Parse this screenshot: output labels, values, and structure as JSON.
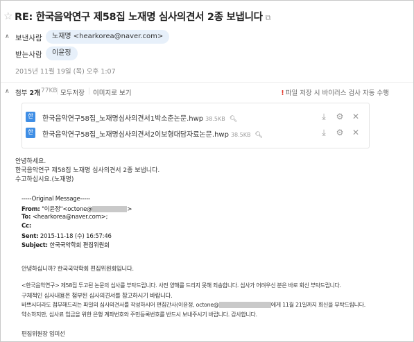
{
  "subject": "RE: 한국음악연구 제58집 노재명 심사의견서 2종 보냅니다",
  "icons": {
    "star": "star-icon",
    "external": "external-link-icon"
  },
  "sender_label": "보낸사람",
  "sender_chip": "노재명 <hearkorea@naver.com>",
  "recipient_label": "받는사람",
  "recipient_chip": "이윤정",
  "date": "2015년 11월 19일 (목) 오후 1:07",
  "attachments": {
    "title_prefix": "첨부",
    "count": "2개",
    "size": "77KB",
    "save_all": "모두저장",
    "image_view": "이미지로 보기",
    "notice_mark": "!",
    "notice": "파일 저장 시 바이러스 검사 자동 수행",
    "files": [
      {
        "icon": "한",
        "name": "한국음악연구58집_노재명심사의견서1박소춘논문.hwp",
        "size": "38.5KB"
      },
      {
        "icon": "한",
        "name": "한국음악연구58집_노재명심사의견서2이보형대담자료논문.hwp",
        "size": "38.5KB"
      }
    ]
  },
  "body_lines": [
    "안녕하세요.",
    "한국음악연구 제58집 노재명 심사의견서 2종 보냅니다.",
    "수고하십시요.(노재명)"
  ],
  "forward": {
    "header": "-----Original Message-----",
    "from_label": "From:",
    "from_value": "\"이윤정\"<octone@",
    "to_label": "To:",
    "to_value": "<hearkorea@naver.com>;",
    "cc_label": "Cc:",
    "sent_label": "Sent:",
    "sent_value": "2015-11-18 (수) 16:57:46",
    "subject_label": "Subject:",
    "subject_value": "한국국악학회 편집위원회"
  },
  "original_lines": [
    "안녕하십니까? 한국국악학회 편집위원회입니다.",
    "<한국음악연구> 제58집 투고된 논문의 심사를 부탁드립니다. 사전 양해를 드리지 못해 죄송합니다. 심사가 어려우신 분은 바로 회신 부탁드립니다.",
    "구체적인 심사내용은 첨부된 심사의견서를 참고하시기 바랍니다.",
    "바쁘시더라도 첨부해드리는 파일의 심사의견서를 작성하시어 편집간사(이윤정, octone@",
    "에게 11월 21일까지 회신을 부탁드립니다.",
    "약소하지만, 심사료 입금을 위한 은행 계좌번호와 주민등록번호를 반드시 보내주시기 바랍니다. 감사합니다.",
    "편집위원장 임미선"
  ]
}
